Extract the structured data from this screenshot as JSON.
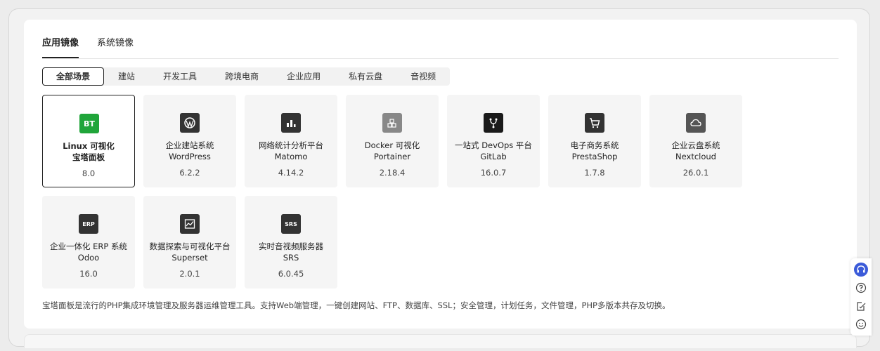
{
  "tabs": [
    {
      "label": "应用镜像",
      "active": true
    },
    {
      "label": "系统镜像",
      "active": false
    }
  ],
  "filters": [
    {
      "label": "全部场景",
      "active": true
    },
    {
      "label": "建站"
    },
    {
      "label": "开发工具"
    },
    {
      "label": "跨境电商"
    },
    {
      "label": "企业应用"
    },
    {
      "label": "私有云盘"
    },
    {
      "label": "音视频"
    }
  ],
  "apps": [
    {
      "line1": "Linux 可视化",
      "line2": "宝塔面板",
      "version": "8.0",
      "icon": "bt-logo-icon",
      "icon_color": "#20a53a",
      "icon_text": "BT",
      "selected": true
    },
    {
      "line1": "企业建站系统",
      "line2": "WordPress",
      "version": "6.2.2",
      "icon": "wordpress-icon"
    },
    {
      "line1": "网络统计分析平台",
      "line2": "Matomo",
      "version": "4.14.2",
      "icon": "bar-chart-icon"
    },
    {
      "line1": "Docker 可视化",
      "line2": "Portainer",
      "version": "2.18.4",
      "icon": "cubes-icon",
      "icon_color": "#888888"
    },
    {
      "line1": "一站式 DevOps 平台",
      "line2": "GitLab",
      "version": "16.0.7",
      "icon": "fork-icon",
      "icon_color": "#1a1a1a"
    },
    {
      "line1": "电子商务系统",
      "line2": "PrestaShop",
      "version": "1.7.8",
      "icon": "cart-icon"
    },
    {
      "line1": "企业云盘系统",
      "line2": "Nextcloud",
      "version": "26.0.1",
      "icon": "cloud-icon",
      "icon_color": "#555555"
    },
    {
      "line1": "企业一体化 ERP 系统",
      "line2": "Odoo",
      "version": "16.0",
      "icon": "erp-icon",
      "icon_text": "ERP"
    },
    {
      "line1": "数据探索与可视化平台",
      "line2": "Superset",
      "version": "2.0.1",
      "icon": "dashboard-chart-icon"
    },
    {
      "line1": "实时音视频服务器",
      "line2": "SRS",
      "version": "6.0.45",
      "icon": "srs-icon",
      "icon_text": "SRS"
    }
  ],
  "description": "宝塔面板是流行的PHP集成环境管理及服务器运维管理工具。支持Web端管理，一键创建网站、FTP、数据库、SSL；安全管理，计划任务，文件管理，PHP多版本共存及切换。",
  "side_tools": [
    "headset-support-icon",
    "help-circle-icon",
    "feedback-edit-icon",
    "smile-icon"
  ],
  "colors": {
    "accent": "#222222",
    "support": "#3b5bd9",
    "bt_green": "#20a53a"
  }
}
